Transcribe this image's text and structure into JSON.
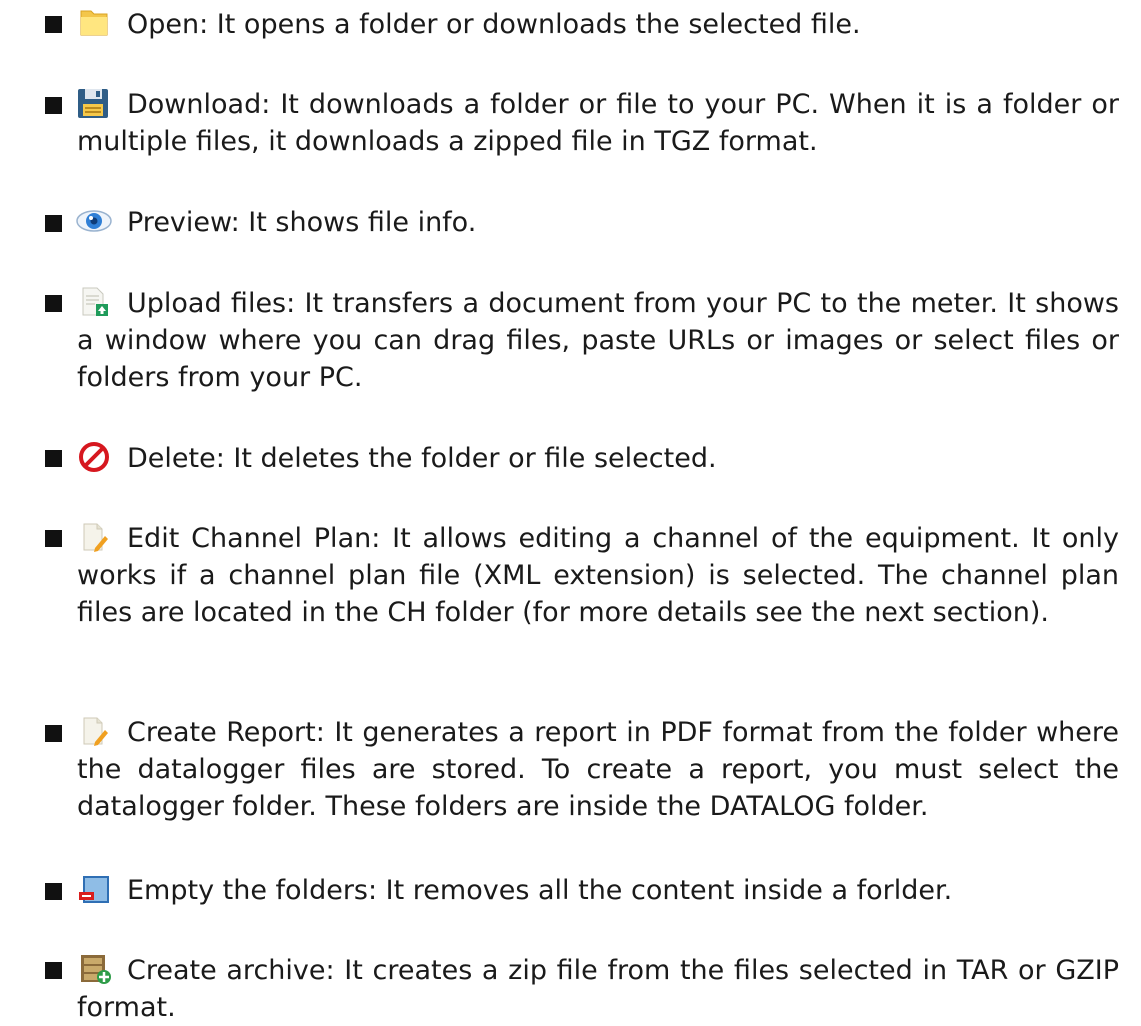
{
  "items": [
    {
      "icon": "folder-icon",
      "text": "Open: It opens a folder or downloads the selected file."
    },
    {
      "icon": "floppy-disk-icon",
      "text": "Download: It downloads a folder or file to your PC. When it is a folder or multiple files, it downloads a zipped file in TGZ format."
    },
    {
      "icon": "eye-icon",
      "text": "Preview: It shows file info."
    },
    {
      "icon": "upload-file-icon",
      "text": "Upload files: It transfers a document from your PC to the meter. It shows a window where you can drag files, paste URLs or images or select files or folders from your PC."
    },
    {
      "icon": "prohibited-icon",
      "text": "Delete: It deletes the folder or file selected."
    },
    {
      "icon": "edit-document-icon",
      "text": "Edit Channel Plan: It allows editing a channel of the equipment. It only works if a channel plan file (XML extension) is selected. The channel plan files are located in the CH folder (for more details see the next section)."
    },
    {
      "icon": "report-document-icon",
      "text": "Create Report: It generates a report in PDF format from the folder where the datalogger files are stored. To create a report, you must select the datalogger folder. These folders are inside the DATALOG folder."
    },
    {
      "icon": "empty-folder-icon",
      "text": "Empty the folders: It removes all the content inside a forlder."
    },
    {
      "icon": "archive-icon",
      "text": "Create archive: It creates a zip file from the files selected in TAR or GZIP format."
    }
  ]
}
